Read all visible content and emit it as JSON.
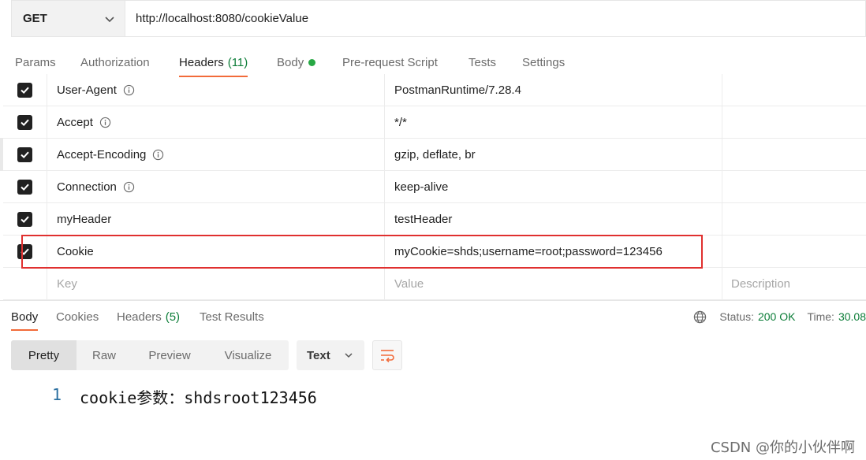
{
  "request": {
    "method": "GET",
    "url": "http://localhost:8080/cookieValue"
  },
  "request_tabs": [
    {
      "label": "Params"
    },
    {
      "label": "Authorization"
    },
    {
      "label": "Headers",
      "count": "(11)"
    },
    {
      "label": "Body"
    },
    {
      "label": "Pre-request Script"
    },
    {
      "label": "Tests"
    },
    {
      "label": "Settings"
    }
  ],
  "active_request_tab": "Headers",
  "headers": [
    {
      "key": "User-Agent",
      "value": "PostmanRuntime/7.28.4",
      "checked": true,
      "info": true
    },
    {
      "key": "Accept",
      "value": "*/*",
      "checked": true,
      "info": true
    },
    {
      "key": "Accept-Encoding",
      "value": "gzip, deflate, br",
      "checked": true,
      "info": true
    },
    {
      "key": "Connection",
      "value": "keep-alive",
      "checked": true,
      "info": true
    },
    {
      "key": "myHeader",
      "value": "testHeader",
      "checked": true,
      "info": false
    },
    {
      "key": "Cookie",
      "value": "myCookie=shds;username=root;password=123456",
      "checked": true,
      "info": false
    }
  ],
  "placeholders": {
    "key": "Key",
    "value": "Value",
    "description": "Description"
  },
  "response_tabs": [
    {
      "label": "Body"
    },
    {
      "label": "Cookies"
    },
    {
      "label": "Headers",
      "count": "(5)"
    },
    {
      "label": "Test Results"
    }
  ],
  "status": {
    "status_label": "Status:",
    "status_value": "200 OK",
    "time_label": "Time:",
    "time_value": "30.08"
  },
  "view_modes": [
    "Pretty",
    "Raw",
    "Preview",
    "Visualize"
  ],
  "active_view_mode": "Pretty",
  "format": "Text",
  "response_body": {
    "line_number": "1",
    "text": "cookie参数：shdsroot123456"
  },
  "watermark": "CSDN @你的小伙伴啊",
  "colors": {
    "accent": "#f26b3a",
    "success": "#0c7d38",
    "dot": "#27a844",
    "highlight_border": "#e0302f"
  }
}
